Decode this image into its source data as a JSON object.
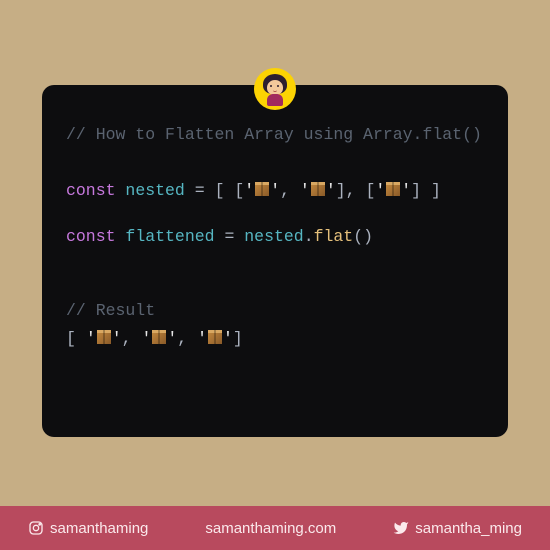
{
  "code": {
    "comment_title": "// How to Flatten Array using Array.flat()",
    "kw_const1": "const",
    "var_nested": "nested",
    "eq": "=",
    "arr_open": "[",
    "arr_close": "]",
    "inner_open": "[",
    "inner_close": "]",
    "comma": ",",
    "box_str_open": "'",
    "box_str_close": "'",
    "kw_const2": "const",
    "var_flattened": "flattened",
    "chain_nested": "nested",
    "dot": ".",
    "method_flat": "flat",
    "paren_open": "(",
    "paren_close": ")",
    "comment_result": "// Result",
    "space": " "
  },
  "footer": {
    "instagram": "samanthaming",
    "website": "samanthaming.com",
    "twitter": "samantha_ming"
  }
}
